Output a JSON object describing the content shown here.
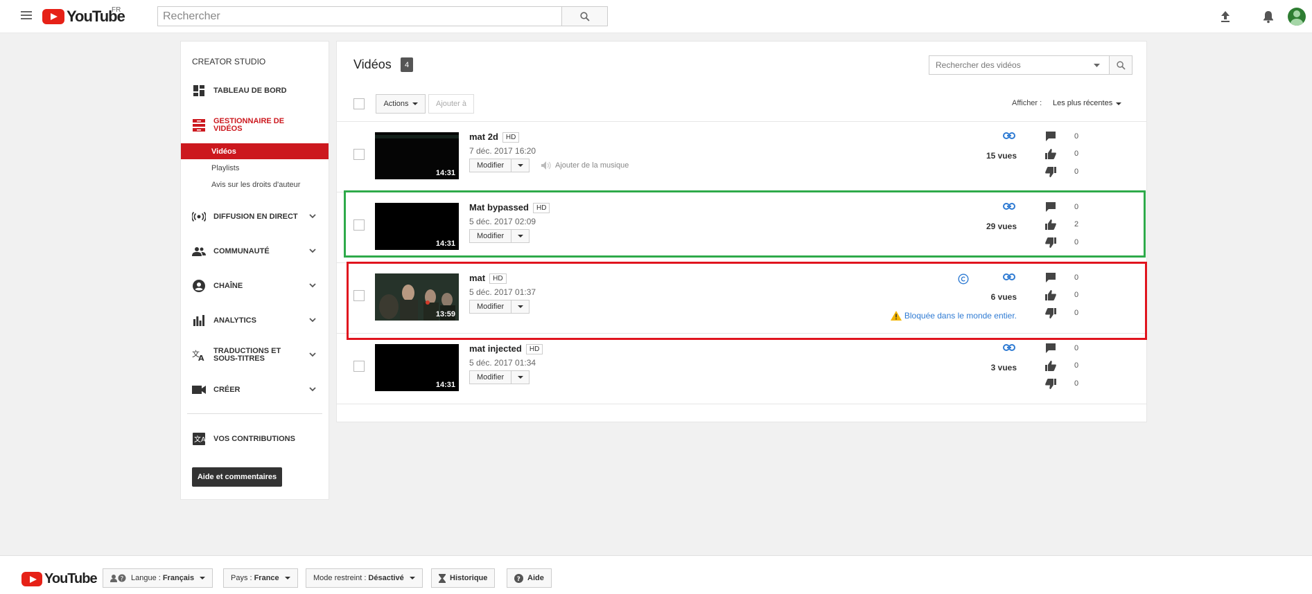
{
  "header": {
    "logo_text": "YouTube",
    "logo_region": "FR",
    "search_placeholder": "Rechercher"
  },
  "sidebar": {
    "title": "CREATOR STUDIO",
    "items": [
      {
        "label": "TABLEAU DE BORD",
        "icon": "dashboard-icon"
      },
      {
        "label": "GESTIONNAIRE DE VIDÉOS",
        "icon": "video-manager-icon",
        "active": true
      },
      {
        "label": "DIFFUSION EN DIRECT",
        "icon": "live-broadcast-icon"
      },
      {
        "label": "COMMUNAUTÉ",
        "icon": "community-icon"
      },
      {
        "label": "CHAÎNE",
        "icon": "channel-icon"
      },
      {
        "label": "ANALYTICS",
        "icon": "analytics-icon"
      },
      {
        "label": "TRADUCTIONS ET SOUS-TITRES",
        "icon": "translate-icon"
      },
      {
        "label": "CRÉER",
        "icon": "create-icon"
      },
      {
        "label": "VOS CONTRIBUTIONS",
        "icon": "contributions-icon"
      }
    ],
    "subitems": [
      "Vidéos",
      "Playlists",
      "Avis sur les droits d'auteur"
    ],
    "help_button": "Aide et commentaires"
  },
  "main": {
    "title": "Vidéos",
    "count": "4",
    "search_placeholder": "Rechercher des vidéos",
    "actions_label": "Actions",
    "add_to_label": "Ajouter à",
    "sort_label": "Afficher :",
    "sort_value": "Les plus récentes",
    "edit_label": "Modifier",
    "hd_label": "HD",
    "music_label": "Ajouter de la musique",
    "videos": [
      {
        "title": "mat 2d",
        "date": "7 déc. 2017 16:20",
        "duration": "14:31",
        "views": "15 vues",
        "comments": "0",
        "likes": "0",
        "dislikes": "0"
      },
      {
        "title": "Mat bypassed",
        "date": "5 déc. 2017 02:09",
        "duration": "14:31",
        "views": "29 vues",
        "comments": "0",
        "likes": "2",
        "dislikes": "0"
      },
      {
        "title": "mat",
        "date": "5 déc. 2017 01:37",
        "duration": "13:59",
        "views": "6 vues",
        "comments": "0",
        "likes": "0",
        "dislikes": "0",
        "blocked": "Bloquée dans le monde entier."
      },
      {
        "title": "mat injected",
        "date": "5 déc. 2017 01:34",
        "duration": "14:31",
        "views": "3 vues",
        "comments": "0",
        "likes": "0",
        "dislikes": "0"
      }
    ]
  },
  "footer": {
    "logo_text": "YouTube",
    "language": {
      "label": "Langue :",
      "value": "Français"
    },
    "country": {
      "label": "Pays :",
      "value": "France"
    },
    "restricted": {
      "label": "Mode restreint :",
      "value": "Désactivé"
    },
    "history": "Historique",
    "help": "Aide"
  },
  "colors": {
    "brand_red": "#e62117",
    "active_red": "#cc181e",
    "link_blue": "#2f7bd3",
    "highlight_green": "#2eaa4a",
    "highlight_red": "#e0141e",
    "warning_yellow": "#f2b400"
  }
}
